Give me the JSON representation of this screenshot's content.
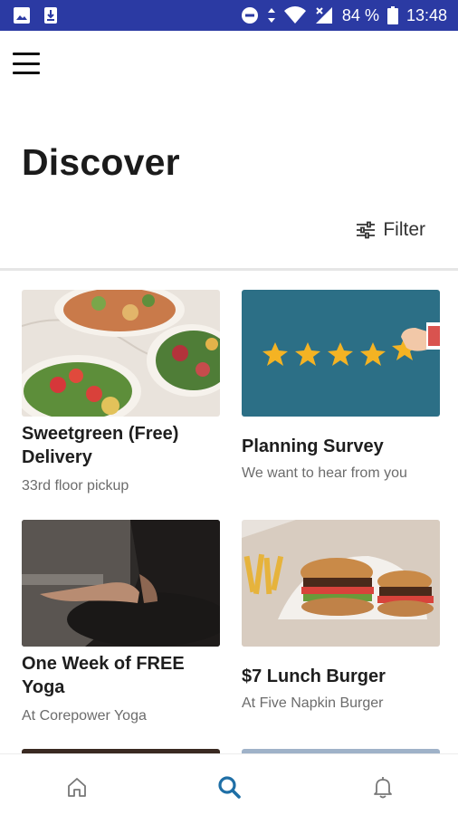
{
  "status_bar": {
    "battery": "84 %",
    "time": "13:48",
    "icons": [
      "image-icon",
      "download-icon",
      "do-not-disturb-icon",
      "data-arrows-icon",
      "wifi-icon",
      "signal-icon",
      "battery-icon"
    ]
  },
  "header": {
    "menu_icon": "hamburger-menu-icon",
    "title": "Discover",
    "filter_label": "Filter",
    "filter_icon": "sliders-icon"
  },
  "cards": [
    {
      "title": "Sweetgreen (Free) Delivery",
      "subtitle": "33rd floor pickup",
      "image": "salad-plates-photo"
    },
    {
      "title": "Planning Survey",
      "subtitle": "We want to hear from you",
      "image": "four-star-rating-illustration"
    },
    {
      "title": "One Week of FREE Yoga",
      "subtitle": "At Corepower Yoga",
      "image": "yoga-meditation-photo"
    },
    {
      "title": "$7 Lunch Burger",
      "subtitle": "At Five Napkin Burger",
      "image": "burgers-and-fries-photo"
    }
  ],
  "bottom_nav": {
    "items": [
      {
        "icon": "home-icon",
        "active": false
      },
      {
        "icon": "search-icon",
        "active": true
      },
      {
        "icon": "bell-icon",
        "active": false
      }
    ],
    "active_color": "#1f6fa6",
    "inactive_color": "#777777"
  },
  "colors": {
    "status_bar": "#2b3aa3",
    "survey_bg": "#2c6f86",
    "star": "#f4b323"
  }
}
